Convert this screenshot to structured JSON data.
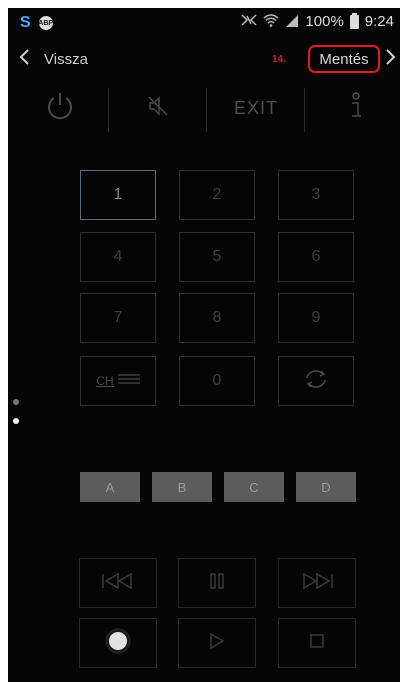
{
  "status": {
    "left_icons": [
      "s-app-icon",
      "abp-icon"
    ],
    "abp_text": "ABP",
    "s_text": "S",
    "battery": "100%",
    "time": "9:24"
  },
  "nav": {
    "back_label": "Vissza",
    "step_marker": "14.",
    "save_label": "Mentés",
    "highlight_color": "#e11a2a"
  },
  "toolbar": {
    "power_icon": "power-icon",
    "mute_icon": "mute-icon",
    "exit_label": "EXIT",
    "info_icon": "info-icon"
  },
  "keypad": {
    "keys": [
      "1",
      "2",
      "3",
      "4",
      "5",
      "6",
      "7",
      "8",
      "9"
    ],
    "ch_label": "CH",
    "zero": "0",
    "swap_icon": "swap-icon",
    "active_key": "1"
  },
  "color_buttons": [
    "A",
    "B",
    "C",
    "D"
  ],
  "media": {
    "row1": [
      "skip-back-icon",
      "pause-icon",
      "skip-forward-icon"
    ],
    "row2": [
      "record-icon",
      "play-icon",
      "stop-icon"
    ]
  }
}
